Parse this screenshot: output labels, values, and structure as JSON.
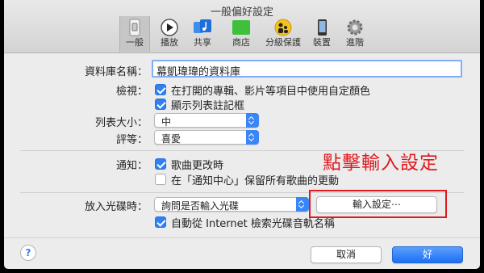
{
  "window": {
    "title": "一般偏好設定"
  },
  "toolbar": {
    "items": [
      {
        "label": "一般",
        "icon": "general-switch-icon",
        "selected": true
      },
      {
        "label": "播放",
        "icon": "play-icon"
      },
      {
        "label": "共享",
        "icon": "shared-music-icon"
      },
      {
        "label": "商店",
        "icon": "store-icon"
      },
      {
        "label": "分級保護",
        "icon": "parental-controls-icon"
      },
      {
        "label": "裝置",
        "icon": "device-icon"
      },
      {
        "label": "進階",
        "icon": "gear-icon"
      }
    ]
  },
  "library": {
    "label": "資料庫名稱：",
    "value": "幕凱瑋瑋的資料庫"
  },
  "view": {
    "label": "檢視：",
    "option1": "在打開的專輯、影片等項目中使用自定顏色",
    "option2": "顯示列表註記框"
  },
  "list_size": {
    "label": "列表大小：",
    "value": "中"
  },
  "rating": {
    "label": "評等：",
    "value": "喜愛"
  },
  "notifications": {
    "label": "通知：",
    "option1": "歌曲更改時",
    "option2": "在「通知中心」保留所有歌曲的更動"
  },
  "cd_insert": {
    "label": "放入光碟時：",
    "value": "詢問是否輸入光碟",
    "import_button": "輸入設定⋯",
    "auto_names": "自動從 Internet 檢索光碟音軌名稱"
  },
  "footer": {
    "help": "?",
    "cancel": "取消",
    "ok": "好"
  },
  "annotation": {
    "text": "點擊輸入設定"
  },
  "colors": {
    "accent": "#2f7ff5",
    "annotation": "#e0191e"
  }
}
